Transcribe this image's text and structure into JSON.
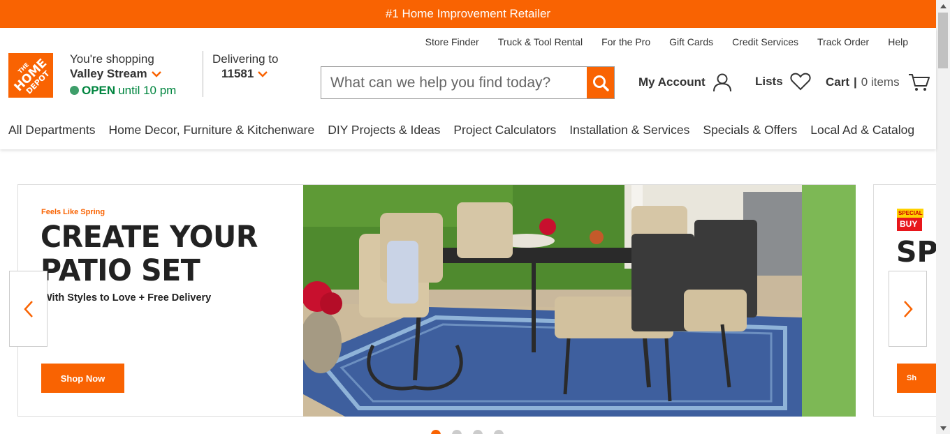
{
  "promo_bar": {
    "text": "#1 Home Improvement Retailer"
  },
  "utility_links": [
    "Store Finder",
    "Truck & Tool Rental",
    "For the Pro",
    "Gift Cards",
    "Credit Services",
    "Track Order",
    "Help"
  ],
  "logo": {
    "alt": "The Home Depot",
    "line1": "THE",
    "line2": "HOME",
    "line3": "DEPOT"
  },
  "store": {
    "shopping_label": "You're shopping",
    "store_name": "Valley Stream",
    "status": "OPEN",
    "hours": "until 10 pm"
  },
  "delivery": {
    "label": "Delivering to",
    "zip": "11581"
  },
  "search": {
    "placeholder": "What can we help you find today?",
    "value": ""
  },
  "account": {
    "label": "My Account",
    "icon": "user-icon"
  },
  "lists": {
    "label": "Lists",
    "icon": "heart-icon"
  },
  "cart": {
    "label": "Cart",
    "separator": "|",
    "items": "0 items",
    "icon": "cart-icon"
  },
  "nav": [
    "All Departments",
    "Home Decor, Furniture & Kitchenware",
    "DIY Projects & Ideas",
    "Project Calculators",
    "Installation & Services",
    "Specials & Offers",
    "Local Ad & Catalog"
  ],
  "hero": {
    "eyebrow": "Feels Like Spring",
    "headline_line1": "CREATE YOUR",
    "headline_line2": "PATIO SET",
    "subhead": "With Styles to Love + Free Delivery",
    "cta": "Shop Now"
  },
  "next_slide": {
    "badge_top": "SPECIAL",
    "badge_bottom": "BUY",
    "headline_partial": "SP",
    "cta_partial": "Sh"
  },
  "carousel": {
    "slide_count": 4,
    "active_index": 0
  },
  "colors": {
    "brand_orange": "#f96302",
    "open_green": "#00853f",
    "text_dark": "#333333"
  }
}
